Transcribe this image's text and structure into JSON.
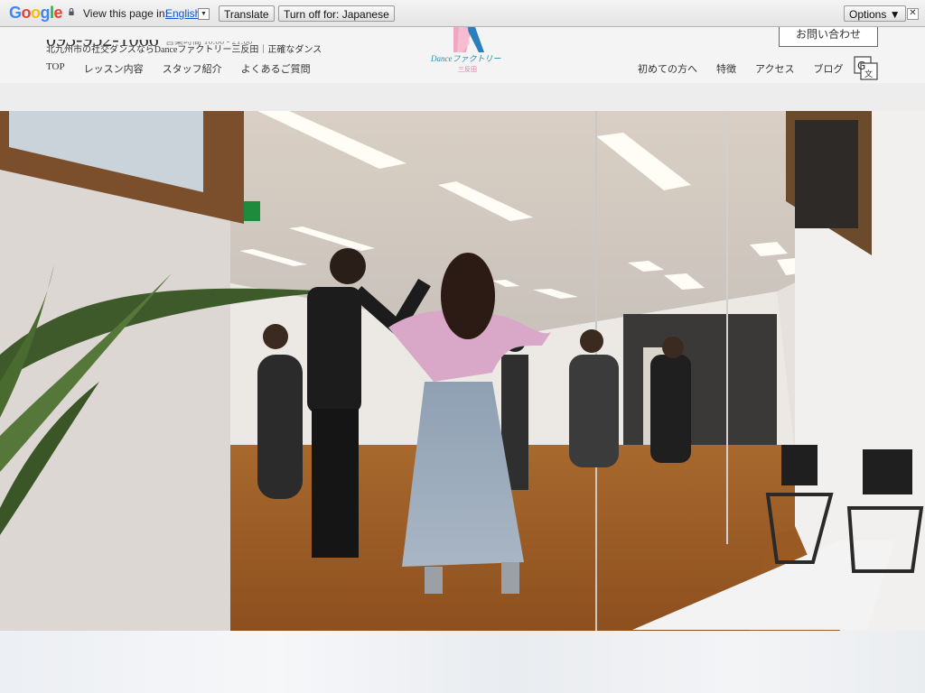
{
  "translate_bar": {
    "logo": "Google",
    "message": "View this page in:",
    "language": "English",
    "translate_label": "Translate",
    "turn_off_label": "Turn off for: Japanese",
    "options_label": "Options ▼",
    "close_symbol": "✕"
  },
  "header": {
    "phone": "093-952-1066",
    "hours": "営業時間 10:00 - 21:00",
    "tagline": "北九州市の社交ダンスならDanceファクトリー三反田｜正確なダンス",
    "logo_text": "Danceファクトリー",
    "logo_sub": "三反田",
    "contact_label": "お問い合わせ",
    "nav_left": [
      "TOP",
      "レッスン内容",
      "スタッフ紹介",
      "よくあるご質問"
    ],
    "nav_right": [
      "初めての方へ",
      "特徴",
      "アクセス",
      "ブログ"
    ],
    "translate_icon": "google-translate-icon"
  },
  "colors": {
    "accent_blue": "#2b8eae",
    "accent_pink": "#e5739f",
    "header_bg": "#f4f4f4"
  }
}
